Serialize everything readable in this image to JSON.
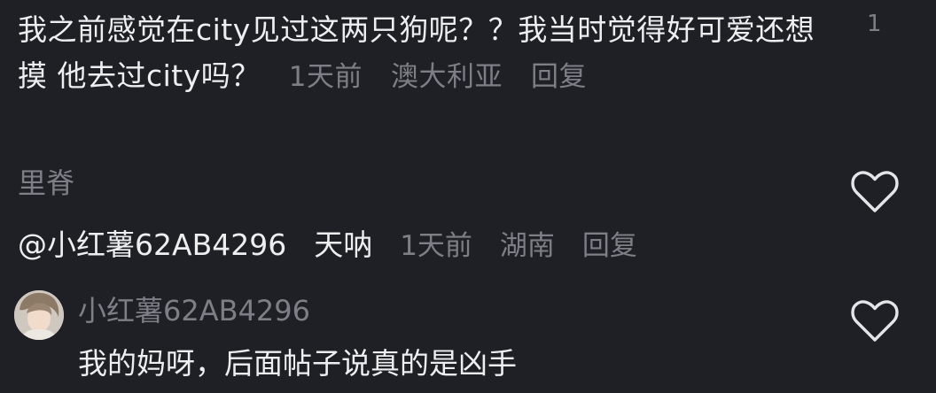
{
  "top_comment": {
    "text": "我之前感觉在city见过这两只狗呢？？我当时觉得好可爱还想摸 他去过city吗？",
    "time": "1天前",
    "location": "澳大利亚",
    "reply_label": "回复",
    "like_count": "1"
  },
  "comment_1": {
    "username": "里脊",
    "mention": "@小红薯62AB4296",
    "text": "天呐",
    "time": "1天前",
    "location": "湖南",
    "reply_label": "回复",
    "like_icon": "heart-outline-icon"
  },
  "comment_2": {
    "username": "小红薯62AB4296",
    "text": "我的妈呀，后面帖子说真的是凶手",
    "avatar_icon": "avatar-photo",
    "like_icon": "heart-outline-icon"
  },
  "colors": {
    "background": "#1f2026",
    "primary_text": "#eceef0",
    "secondary_text": "#7d7f86"
  }
}
